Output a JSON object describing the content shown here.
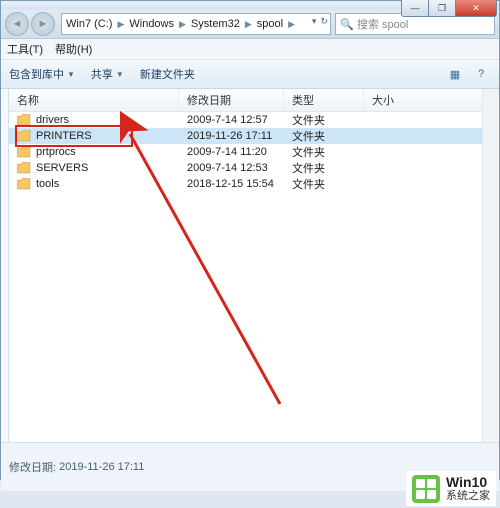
{
  "window": {
    "controls": {
      "min": "—",
      "max": "❐",
      "close": "✕"
    }
  },
  "address": {
    "crumbs": [
      "Win7 (C:)",
      "Windows",
      "System32",
      "spool"
    ],
    "refresh": "↻"
  },
  "search": {
    "placeholder": "搜索 spool",
    "icon": "🔍"
  },
  "menubar": {
    "items": [
      "工具(T)",
      "帮助(H)"
    ]
  },
  "toolbar": {
    "organize": "包含到库中",
    "share": "共享",
    "newFolder": "新建文件夹",
    "viewIcon": "▦",
    "helpIcon": "?"
  },
  "columns": {
    "name": "名称",
    "date": "修改日期",
    "type": "类型",
    "size": "大小"
  },
  "rows": [
    {
      "name": "drivers",
      "date": "2009-7-14 12:57",
      "type": "文件夹",
      "selected": false
    },
    {
      "name": "PRINTERS",
      "date": "2019-11-26 17:11",
      "type": "文件夹",
      "selected": true
    },
    {
      "name": "prtprocs",
      "date": "2009-7-14 11:20",
      "type": "文件夹",
      "selected": false
    },
    {
      "name": "SERVERS",
      "date": "2009-7-14 12:53",
      "type": "文件夹",
      "selected": false
    },
    {
      "name": "tools",
      "date": "2018-12-15 15:54",
      "type": "文件夹",
      "selected": false
    }
  ],
  "details": {
    "label": "修改日期:",
    "value": "2019-11-26 17:11"
  },
  "watermark": {
    "line1": "Win10",
    "line2": "系统之家"
  },
  "annotation": {
    "highlight_row_index": 1
  }
}
